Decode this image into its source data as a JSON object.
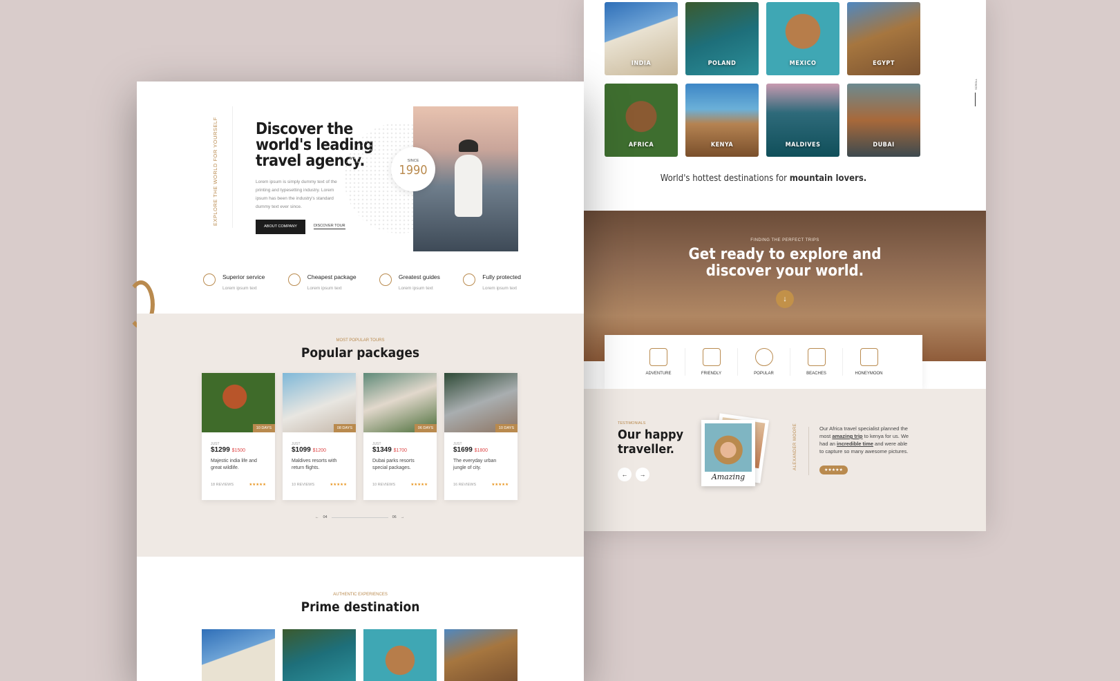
{
  "right": {
    "destinations_row1": [
      "INDIA",
      "POLAND",
      "MEXICO",
      "EGYPT"
    ],
    "destinations_row2": [
      "AFRICA",
      "KENYA",
      "MALDIVES",
      "DUBAI"
    ],
    "hottest_prefix": "World's hottest destinations for ",
    "hottest_bold": "mountain lovers.",
    "scroll_label": "SCROLL",
    "banner_kicker": "FINDING THE PERFECT TRIPS",
    "banner_title_1": "Get ready to explore and",
    "banner_title_2": "discover your world.",
    "categories": [
      "ADVENTURE",
      "FRIENDLY",
      "POPULAR",
      "BEACHES",
      "HONEYMOON"
    ],
    "testimonials_kicker": "TESTIMONIALS",
    "testimonials_title_1": "Our happy",
    "testimonials_title_2": "traveller.",
    "polaroid_caption": "Amazing",
    "reviewer": "ALEXANDER MOORE",
    "quote_1": "Our Africa travel specialist planned the most ",
    "quote_b1": "amazing trip",
    "quote_2": " to kenya for us. We had an ",
    "quote_b2": "incredible time",
    "quote_3": " and were able to capture so many awesome pictures.",
    "quote_stars": "★★★★★"
  },
  "left": {
    "vertical_tag": "EXPLORE THE WORLD FOR YOURSELF",
    "hero_title_1": "Discover the",
    "hero_title_2": "world's leading",
    "hero_title_3": "travel agency.",
    "hero_text": "Lorem ipsum is simply dummy text of the printing and typesetting industry. Lorem ipsum has been the industry's standard dummy text ever since.",
    "btn_about": "ABOUT COMPANY",
    "btn_discover": "DISCOVER TOUR",
    "since_label": "SINCE",
    "since_year": "1990",
    "features": [
      {
        "title": "Superior service",
        "sub": "Lorem ipsum text"
      },
      {
        "title": "Cheapest package",
        "sub": "Lorem ipsum text"
      },
      {
        "title": "Greatest guides",
        "sub": "Lorem ipsum text"
      },
      {
        "title": "Fully protected",
        "sub": "Lorem ipsum text"
      }
    ],
    "popular_kicker": "MOST POPULAR TOURS",
    "popular_title": "Popular packages",
    "packages": [
      {
        "days": "10 DAYS",
        "just": "JUST",
        "price": "$1299",
        "old": "$1500",
        "desc": "Majestic india life and great wildlife.",
        "reviews": "18 REVIEWS",
        "stars": "★★★★★"
      },
      {
        "days": "08 DAYS",
        "just": "JUST",
        "price": "$1099",
        "old": "$1200",
        "desc": "Maldives resorts with return flights.",
        "reviews": "10 REVIEWS",
        "stars": "★★★★★"
      },
      {
        "days": "06 DAYS",
        "just": "JUST",
        "price": "$1349",
        "old": "$1700",
        "desc": "Dubai parks resorts special packages.",
        "reviews": "10 REVIEWS",
        "stars": "★★★★★"
      },
      {
        "days": "10 DAYS",
        "just": "JUST",
        "price": "$1699",
        "old": "$1800",
        "desc": "The everyday urban jungle of city.",
        "reviews": "16 REVIEWS",
        "stars": "★★★★★"
      }
    ],
    "pager_start": "04",
    "pager_end": "06",
    "prime_kicker": "AUTHENTIC EXPERIENCES",
    "prime_title": "Prime destination"
  }
}
